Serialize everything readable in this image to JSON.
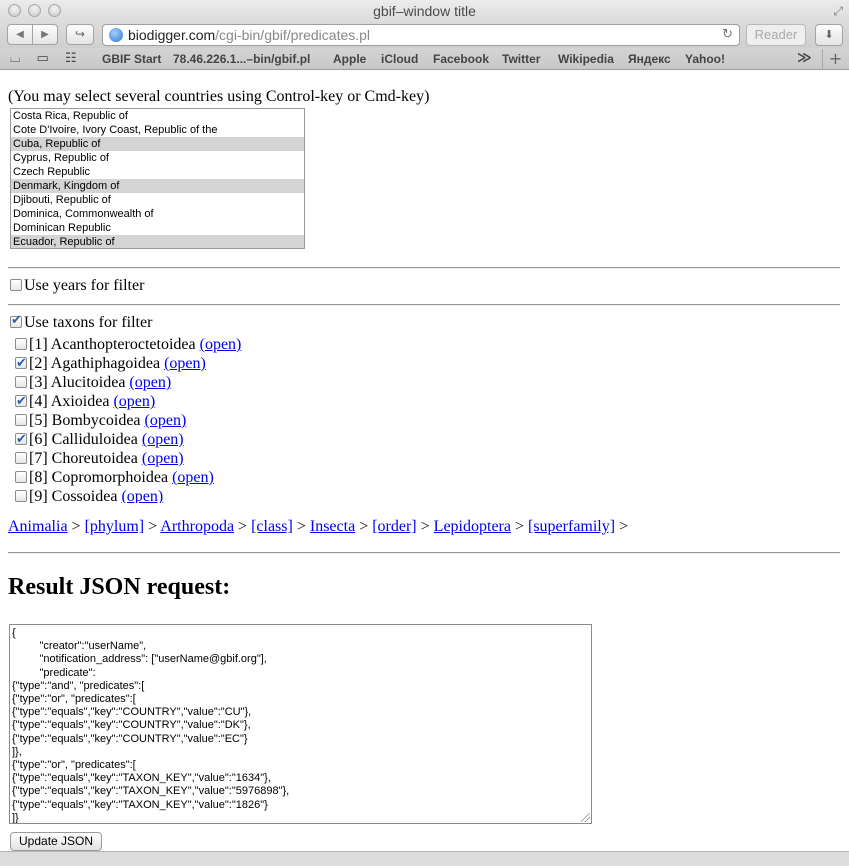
{
  "window": {
    "title": "gbif–window title"
  },
  "toolbar": {
    "back_icon": "◀",
    "forward_icon": "▶",
    "share_icon": "↪",
    "url_host": "biodigger.com",
    "url_path": "/cgi-bin/gbif/predicates.pl",
    "reload_icon": "↻",
    "reader_label": "Reader",
    "download_icon": "⬇"
  },
  "bookmarks": {
    "icons": "⌴ ▭ ☷",
    "items": [
      "GBIF Start",
      "78.46.226.1...–bin/gbif.pl",
      "Apple",
      "iCloud",
      "Facebook",
      "Twitter",
      "Wikipedia",
      "Яндекс",
      "Yahoo!"
    ],
    "more_icon": "≫",
    "add_icon": "+"
  },
  "page": {
    "country_hint": "(You may select several countries using Control-key or Cmd-key)",
    "countries": [
      {
        "label": "Costa Rica, Republic of",
        "selected": false
      },
      {
        "label": "Cote D'Ivoire, Ivory Coast, Republic of the",
        "selected": false
      },
      {
        "label": "Cuba, Republic of",
        "selected": true
      },
      {
        "label": "Cyprus, Republic of",
        "selected": false
      },
      {
        "label": "Czech Republic",
        "selected": false
      },
      {
        "label": "Denmark, Kingdom of",
        "selected": true
      },
      {
        "label": "Djibouti, Republic of",
        "selected": false
      },
      {
        "label": "Dominica, Commonwealth of",
        "selected": false
      },
      {
        "label": "Dominican Republic",
        "selected": false
      },
      {
        "label": "Ecuador, Republic of",
        "selected": true
      }
    ],
    "use_years_label": "Use years for filter",
    "use_years_checked": false,
    "use_taxons_label": "Use taxons for filter",
    "use_taxons_checked": true,
    "open_link": "(open)",
    "taxons": [
      {
        "index": "[1]",
        "name": "Acanthopteroctetoidea",
        "checked": false
      },
      {
        "index": "[2]",
        "name": "Agathiphagoidea",
        "checked": true
      },
      {
        "index": "[3]",
        "name": "Alucitoidea",
        "checked": false
      },
      {
        "index": "[4]",
        "name": "Axioidea",
        "checked": true
      },
      {
        "index": "[5]",
        "name": "Bombycoidea",
        "checked": false
      },
      {
        "index": "[6]",
        "name": "Calliduloidea",
        "checked": true
      },
      {
        "index": "[7]",
        "name": "Choreutoidea",
        "checked": false
      },
      {
        "index": "[8]",
        "name": "Copromorphoidea",
        "checked": false
      },
      {
        "index": "[9]",
        "name": "Cossoidea",
        "checked": false
      }
    ],
    "breadcrumb": [
      {
        "label": "Animalia"
      },
      {
        "label": "[phylum]"
      },
      {
        "label": "Arthropoda"
      },
      {
        "label": "[class]"
      },
      {
        "label": "Insecta"
      },
      {
        "label": "[order]"
      },
      {
        "label": "Lepidoptera"
      },
      {
        "label": "[superfamily]"
      }
    ],
    "breadcrumb_sep": ">",
    "result_heading": "Result JSON request:",
    "json_text": "{\n         \"creator\":\"userName\",\n         \"notification_address\": [\"userName@gbif.org\"],\n         \"predicate\":\n{\"type\":\"and\", \"predicates\":[\n{\"type\":\"or\", \"predicates\":[\n{\"type\":\"equals\",\"key\":\"COUNTRY\",\"value\":\"CU\"},\n{\"type\":\"equals\",\"key\":\"COUNTRY\",\"value\":\"DK\"},\n{\"type\":\"equals\",\"key\":\"COUNTRY\",\"value\":\"EC\"}\n]},\n{\"type\":\"or\", \"predicates\":[\n{\"type\":\"equals\",\"key\":\"TAXON_KEY\",\"value\":\"1634\"},\n{\"type\":\"equals\",\"key\":\"TAXON_KEY\",\"value\":\"5976898\"},\n{\"type\":\"equals\",\"key\":\"TAXON_KEY\",\"value\":\"1826\"}\n]}",
    "update_button": "Update JSON"
  }
}
